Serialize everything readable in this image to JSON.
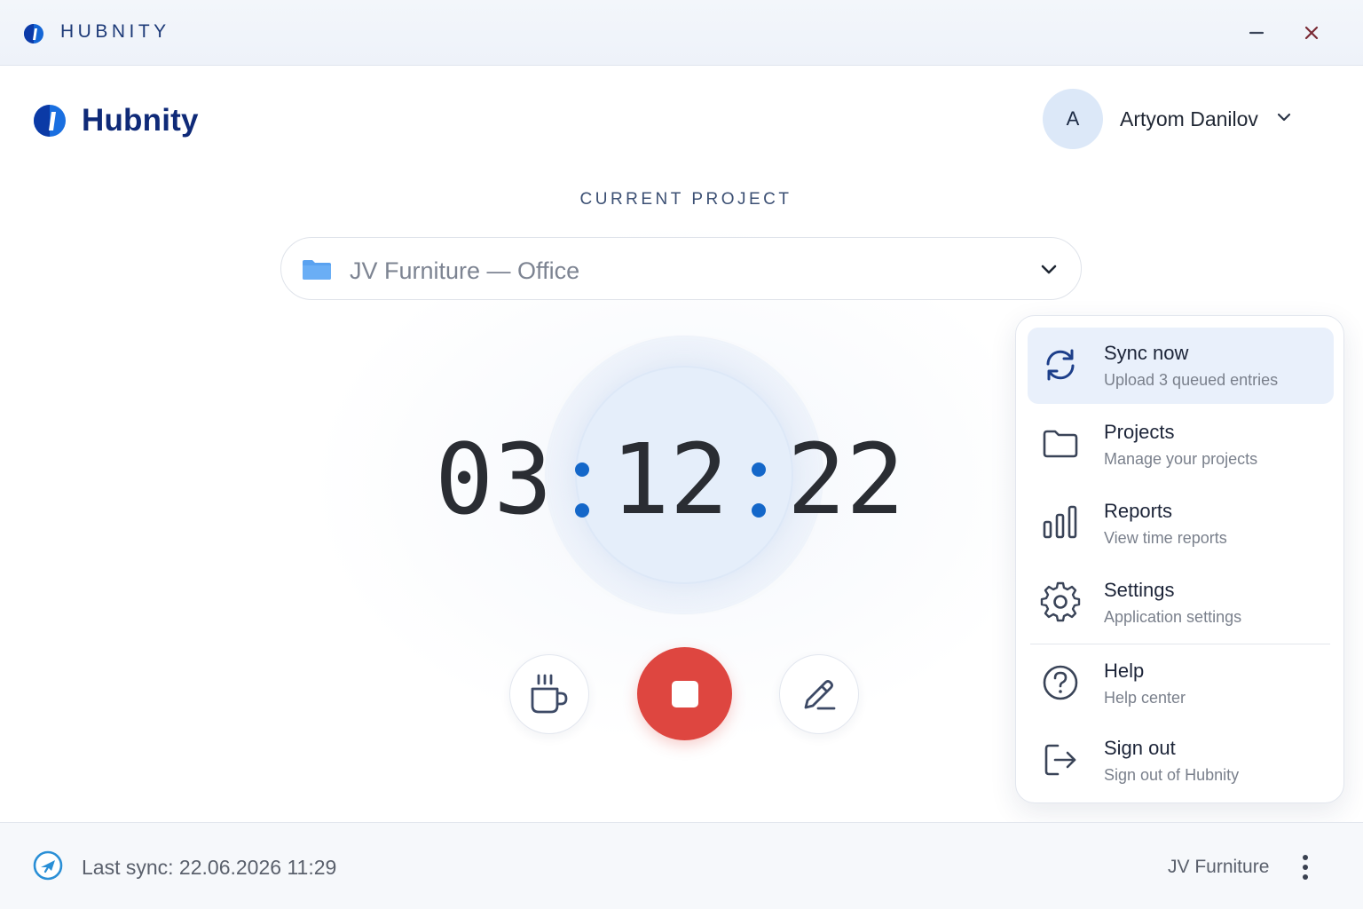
{
  "titlebar": {
    "title": "HUBNITY",
    "logo_icon": "hubnity-logo-icon",
    "minimize_icon": "minimize-icon",
    "close_icon": "close-icon"
  },
  "brand": {
    "name": "Hubnity",
    "logo_icon": "hubnity-logo-icon"
  },
  "user": {
    "initial": "A",
    "name": "Artyom Danilov",
    "chevron_icon": "chevron-down-icon"
  },
  "project": {
    "label": "CURRENT PROJECT",
    "selected": "JV Furniture — Office",
    "icon": "folder-icon"
  },
  "timer": {
    "hours": "03",
    "minutes": "12",
    "seconds": "22"
  },
  "controls": {
    "break_icon": "coffee-cup-icon",
    "stop_icon": "stop-icon",
    "edit_icon": "pencil-icon"
  },
  "menu": {
    "items": [
      {
        "title": "Sync now",
        "subtitle": "Upload 3 queued entries",
        "icon": "sync-icon",
        "active": true
      },
      {
        "title": "Projects",
        "subtitle": "Manage your projects",
        "icon": "folder-icon"
      },
      {
        "title": "Reports",
        "subtitle": "View time reports",
        "icon": "bar-chart-icon"
      },
      {
        "title": "Settings",
        "subtitle": "Application settings",
        "icon": "gear-icon"
      },
      {
        "title": "Help",
        "subtitle": "Help center",
        "icon": "help-icon"
      },
      {
        "title": "Sign out",
        "subtitle": "Sign out of Hubnity",
        "icon": "sign-out-icon"
      }
    ]
  },
  "footer": {
    "last_sync": "Last sync: 22.06.2026 11:29",
    "company": "JV Furniture",
    "sync_status_icon": "sync-status-icon",
    "more_icon": "more-vertical-icon"
  },
  "colors": {
    "brand": "#0f2a78",
    "accent": "#1467c9",
    "stop": "#de4640",
    "menu_active": "#e9f0fb"
  }
}
